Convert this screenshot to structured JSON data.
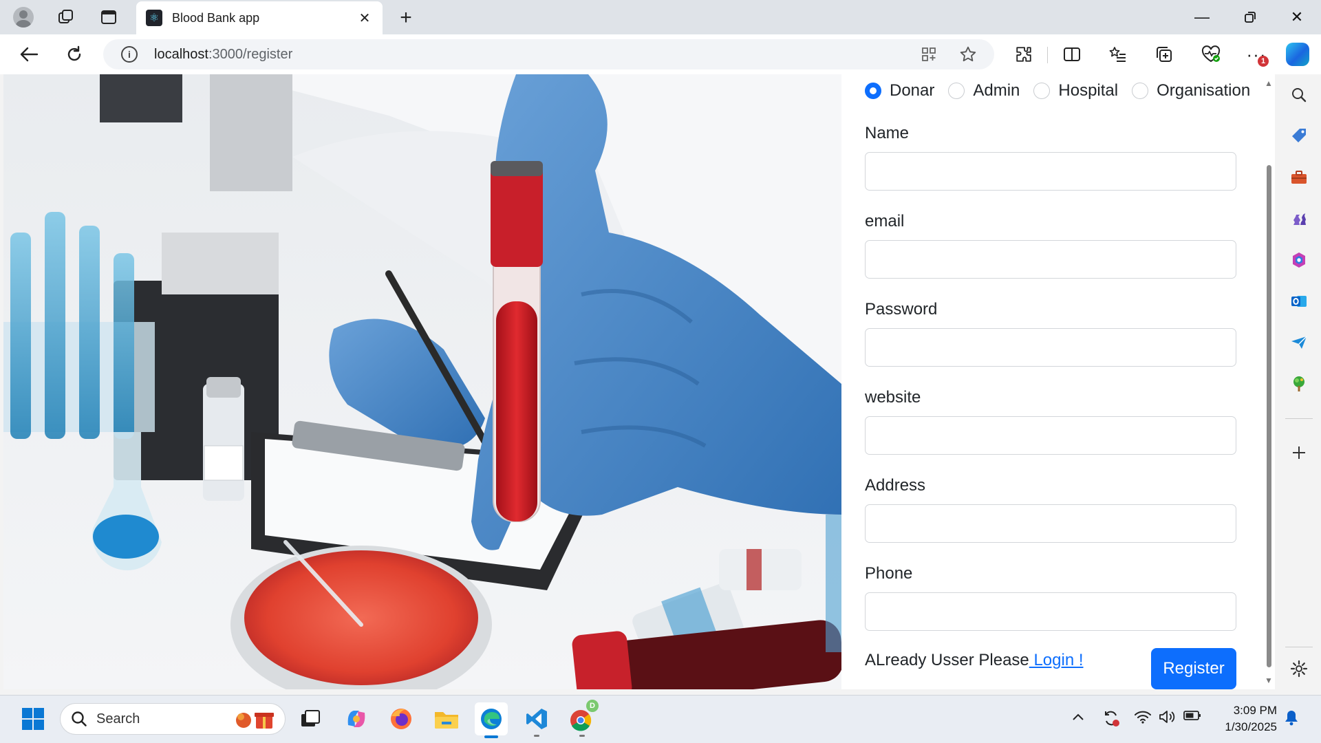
{
  "browser": {
    "tab_title": "Blood Bank app",
    "url_host": "localhost",
    "url_path": ":3000/register",
    "notification_count": "1"
  },
  "form": {
    "roles": [
      {
        "label": "Donar",
        "checked": true
      },
      {
        "label": "Admin",
        "checked": false
      },
      {
        "label": "Hospital",
        "checked": false
      },
      {
        "label": "Organisation",
        "checked": false
      }
    ],
    "fields": {
      "name_label": "Name",
      "email_label": "email",
      "password_label": "Password",
      "website_label": "website",
      "address_label": "Address",
      "phone_label": "Phone"
    },
    "footer_text": "ALready Usser Please",
    "login_link": " Login !",
    "register_label": "Register"
  },
  "taskbar": {
    "search_placeholder": "Search",
    "time": "3:09 PM",
    "date": "1/30/2025",
    "chrome_profile_letter": "D"
  },
  "colors": {
    "accent": "#0d6efd",
    "edge_blue": "#0078d4"
  }
}
